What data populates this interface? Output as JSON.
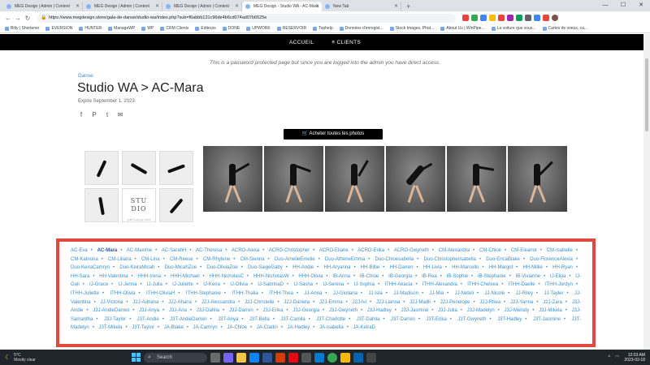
{
  "browser": {
    "tabs": [
      {
        "label": "MEG Design | Admin | Content",
        "active": false
      },
      {
        "label": "MEG Design | Admin | Content",
        "active": false
      },
      {
        "label": "MEG Design | Admin | Content",
        "active": false
      },
      {
        "label": "MEG Design - Studio WA - AC-Mara",
        "active": true
      },
      {
        "label": "New Tab",
        "active": false
      }
    ],
    "url": "https://www.megdesign.store/gala-de-danse/studio-wa/index.php?sub=f6abbb131c96de4b6cd074ad07b6525e",
    "bookmarks": [
      "Bitly | Shortener",
      "EVERSION",
      "HUNTER",
      "ManageWP",
      "WP",
      "CRM Clients",
      "Editeurs",
      "DONE",
      "UPWORK",
      "RESERVOIR",
      "Tophelp",
      "Données d'enregist...",
      "Stock Images, Phot...",
      "About Us | WinPipe...",
      "La voiture que vous...",
      "Cartes de voeux, ca..."
    ]
  },
  "site": {
    "nav": [
      "ACCUEIL",
      "≡ CLIENTS"
    ],
    "notice": "This is a password protected page but since you are logged into the admin you have direct access.",
    "category": "Danse",
    "title": "Studio WA > AC-Mara",
    "expire": "Expire September 1, 2023",
    "buy_label": "Acheter toutes les photos",
    "studio_logo": "STU DIO",
    "studio_caption": "JoBi Cottrupt 2023"
  },
  "names": [
    "AC-Eva",
    "AC-Mara",
    "AC-Maxime",
    "AC-SarahH",
    "AC-Theresa",
    "ACRO-Alexa",
    "ACRO-Christopher",
    "ACRO-Eliane",
    "ACRO-Erika",
    "ACRO-Gwyneth",
    "CM-Alexandra",
    "CM-Chloe",
    "CM-Eleanor",
    "CM-Isabelle",
    "CM-Katriona",
    "CM-Liliana",
    "CM-Lina",
    "CM-Reese",
    "CM-Rhylene",
    "CM-Sienna",
    "Duo-AmelieEmelie",
    "Duo-AtheneEmma",
    "Duo-Chloesabella",
    "Duo-Christopherisabella",
    "Duo-EricaBlake",
    "Duo-FlorenceAlexia",
    "Duo-KeiraCamryn",
    "Duo-KeiraMicah",
    "Duo-MicahZoe",
    "Duo-OliviaZoe",
    "Duo-SaigeGaby",
    "HH-Andie",
    "HH-Aryanna",
    "HH-Billie",
    "HH-Darren",
    "HH-Livia",
    "HH-Marcello",
    "HH-Margot",
    "HH-Millie",
    "HH-Ryan",
    "HH-Sara",
    "HH-Valentina",
    "HHH-Irena",
    "HHH-Michael",
    "HHH-NicholasC",
    "HHH-NicholasW",
    "HHH-Olivia",
    "IB-Anna",
    "IB-Chloe",
    "IB-Georgia",
    "IB-Rea",
    "IB-Sophie",
    "IB-Stephanie",
    "IB-Vivianne",
    "IJ-Elijia",
    "IJ-Gali",
    "IJ-Grace",
    "IJ-Jenna",
    "IJ-Julia",
    "IJ-Juliette",
    "IJ-Keira",
    "IJ-Olivia",
    "IJ-SabrinaD",
    "IJ-Sasha",
    "IJ-Serena",
    "IJ-Sophia",
    "ITHH-Akacia",
    "ITHH-Alexandra",
    "ITHH-Chelsea",
    "ITHH-Daelle",
    "ITHH-Jordyn",
    "ITHH-Juliette",
    "ITHH-Olivia",
    "ITHH-OliviaH",
    "ITHH-Stephanie",
    "ITHH-Thalia",
    "ITHH-Thea",
    "JJ-Anna",
    "JJ-Giuliana",
    "JJ-Isla",
    "JJ-Madison",
    "JJ-Mia",
    "JJ-Neteli",
    "JJ-Nicole",
    "JJ-Riley",
    "JJ-Tayler",
    "JJ-Valentina",
    "JJ-Victoria",
    "J2J-Adriana",
    "J2J-Ahana",
    "J2J-Alessandra",
    "J2J-Christelle",
    "J2J-Daniela",
    "J2J-Emma",
    "J2J-Ivi",
    "J2J-Lianna",
    "J2J-Madli",
    "J2J-Penelope",
    "J2J-Rhea",
    "J2J-Yanna",
    "J2J-Zara",
    "J3J-Andie",
    "J3J-AndieDarren",
    "J3J-Anya",
    "J3J-Aria",
    "J3J-Dahlia",
    "J3J-Darren",
    "J3J-Erika",
    "J3J-Georgia",
    "J3J-Gwyneth",
    "J3J-Hadley",
    "J3J-Jasmine",
    "J3J-Julia",
    "J3J-Madelyn",
    "J3J-Melody",
    "J3J-Mikela",
    "J3J-Samantha",
    "J3J-Taylor",
    "J3T-Andie",
    "J3T-AndieDarren",
    "J3T-Anya",
    "J3T-Bella",
    "J3T-Camila",
    "J3T-Charlotte",
    "J3T-Dahlia",
    "J3T-Darren",
    "J3T-Erika",
    "J3T-Gwyneth",
    "J3T-Hadley",
    "J3T-Jasmine",
    "J3T-Madelyn",
    "J3T-Mikela",
    "J3T-Taylor",
    "JA-Blake",
    "JA-Camryn",
    "JA-Chloe",
    "JA-Cladiri",
    "JA-Hadley",
    "JA-Isabella",
    "JA-KeiraD"
  ],
  "current_name": "AC-Mara",
  "taskbar": {
    "weather_temp": "5°C",
    "weather_desc": "Mostly clear",
    "search_label": "Search",
    "time": "12:03 AM",
    "date": "2023-03-18"
  },
  "colors": {
    "link": "#3a8fd0",
    "highlight_border": "#e04a3d",
    "nav_bg": "#000000"
  }
}
